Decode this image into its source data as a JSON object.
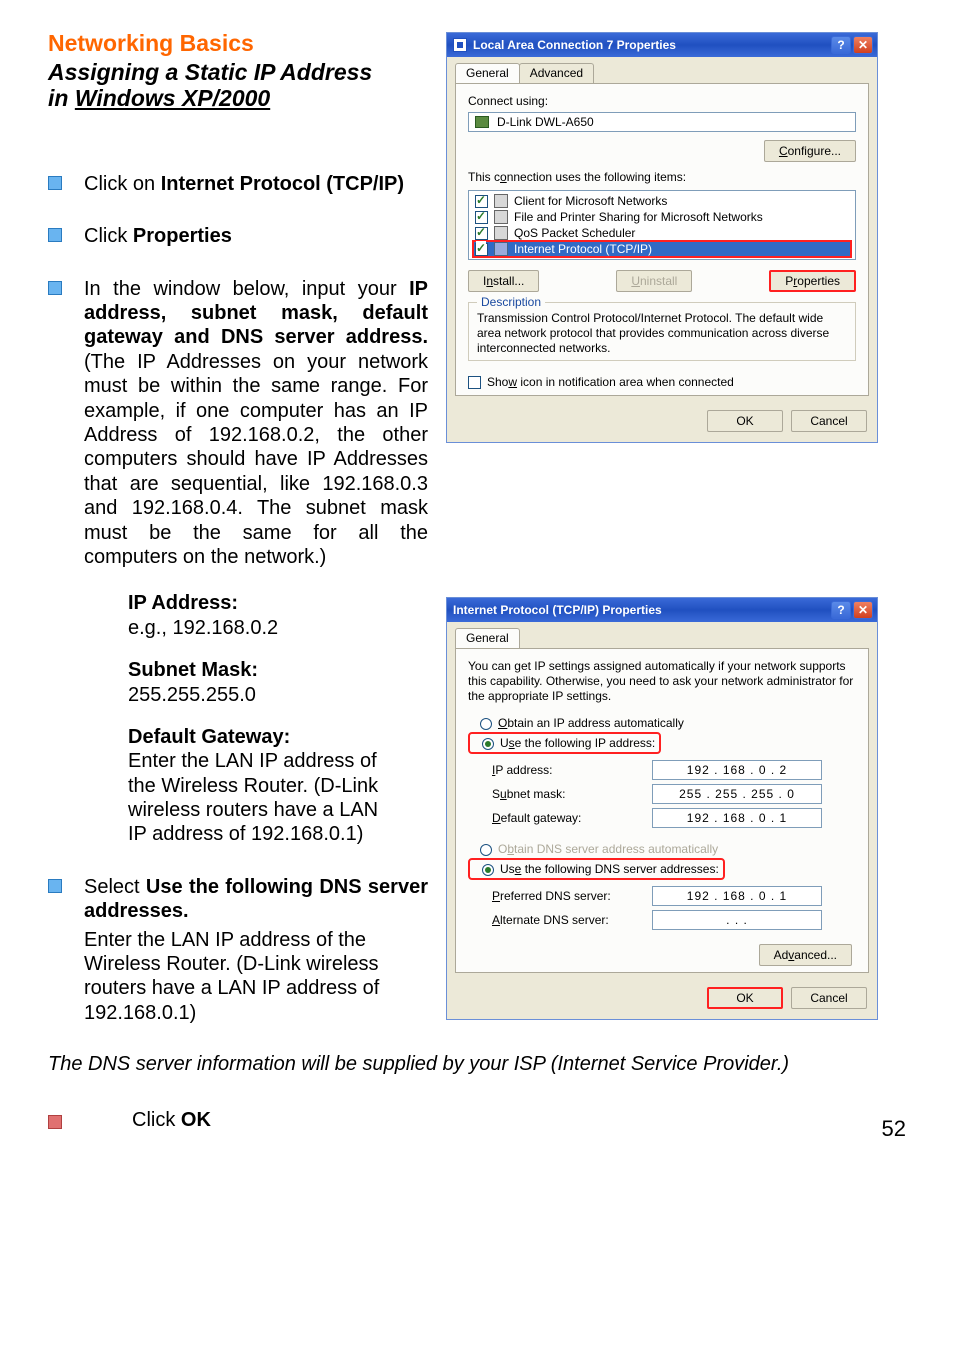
{
  "header": {
    "title_red": "Networking Basics",
    "subtitle_line1": "Assigning a Static IP Address",
    "subtitle_line2_prefix": "in ",
    "subtitle_line2_underlined": "Windows XP/2000"
  },
  "bullets": {
    "b1_pre": "Click on ",
    "b1_bold": "Internet Protocol (TCP/IP)",
    "b2_pre": "Click ",
    "b2_bold": "Properties",
    "b3_pre": " In the window below, input your ",
    "b3_bold": "IP address, subnet mask, default gateway and DNS server address.",
    "b3_rest": " (The IP Addresses on your network must be within the same range. For example, if one computer has an IP Address of 192.168.0.2, the other computers should have IP Addresses that are sequential, like 192.168.0.3 and 192.168.0.4.  The subnet mask must be the same for all the computers on the network.)"
  },
  "fields_block": {
    "ip_label": "IP Address:",
    "ip_eg": "e.g., 192.168.0.2",
    "sn_label": "Subnet Mask:",
    "sn_val": "255.255.255.0",
    "gw_label": "Default Gateway:",
    "gw_text": "Enter the LAN IP address of the Wireless Router. (D-Link wireless routers have a LAN IP address of 192.168.0.1)"
  },
  "dns_bullet": {
    "pre": "Select ",
    "bold": "Use the following DNS server addresses.",
    "sub": "Enter the LAN IP address of the Wireless Router. (D-Link wireless routers have a LAN IP address of 192.168.0.1)"
  },
  "footer_note": "The DNS server information will be supplied by your ISP (Internet Service Provider.)",
  "click_ok": {
    "pre": "Click ",
    "bold": "OK"
  },
  "page_number": "52",
  "dlg1": {
    "title": "Local Area Connection 7 Properties",
    "tab_general": "General",
    "tab_advanced": "Advanced",
    "connect_using": "Connect using:",
    "adapter": "D-Link DWL-A650",
    "configure": "Configure...",
    "items_label": "This connection uses the following items:",
    "item1": "Client for Microsoft Networks",
    "item2": "File and Printer Sharing for Microsoft Networks",
    "item3": "QoS Packet Scheduler",
    "item4": "Internet Protocol (TCP/IP)",
    "install": "Install...",
    "uninstall": "Uninstall",
    "properties": "Properties",
    "desc_title": "Description",
    "desc_text": "Transmission Control Protocol/Internet Protocol. The default wide area network protocol that provides communication across diverse interconnected networks.",
    "show_icon": "Show icon in notification area when connected",
    "ok": "OK",
    "cancel": "Cancel",
    "help_q": "?",
    "close_x": "✕"
  },
  "dlg2": {
    "title": "Internet Protocol (TCP/IP) Properties",
    "tab_general": "General",
    "intro": "You can get IP settings assigned automatically if your network supports this capability. Otherwise, you need to ask your network administrator for the appropriate IP settings.",
    "r_auto_ip": "Obtain an IP address automatically",
    "r_use_ip": "Use the following IP address:",
    "lbl_ip": "IP address:",
    "lbl_sn": "Subnet mask:",
    "lbl_gw": "Default gateway:",
    "val_ip": "192 . 168 .   0  .   2",
    "val_sn": "255 . 255 . 255 .   0",
    "val_gw": "192 . 168 .   0  .   1",
    "r_auto_dns": "Obtain DNS server address automatically",
    "r_use_dns": "Use the following DNS server addresses:",
    "lbl_pref": "Preferred DNS server:",
    "lbl_alt": "Alternate DNS server:",
    "val_pref": "192 . 168 .   0  .   1",
    "val_alt": ".        .        .",
    "advanced": "Advanced...",
    "ok": "OK",
    "cancel": "Cancel",
    "help_q": "?",
    "close_x": "✕"
  }
}
